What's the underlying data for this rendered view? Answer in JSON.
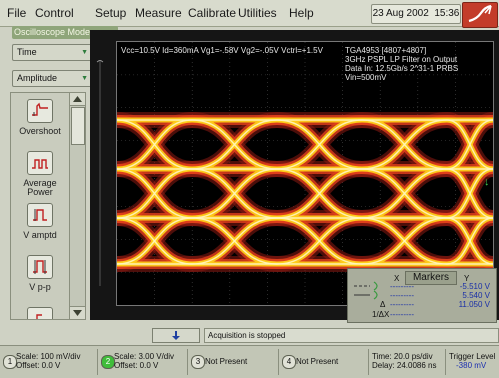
{
  "menu": {
    "items": [
      "File",
      "Control",
      "Setup",
      "Measure",
      "Calibrate",
      "Utilities",
      "Help"
    ],
    "date": "23 Aug 2002",
    "time": "15:36"
  },
  "mode_label": "Oscilloscope Mode",
  "left_panel": {
    "time_dropdown": "Time",
    "amplitude_dropdown": "Amplitude",
    "measurements": [
      {
        "label": "Overshoot",
        "icon": "overshoot-icon"
      },
      {
        "label": "Average Power",
        "icon": "average-power-icon"
      },
      {
        "label": "V amptd",
        "icon": "v-amplitude-icon"
      },
      {
        "label": "V p-p",
        "icon": "v-peak-to-peak-icon"
      }
    ]
  },
  "display": {
    "conditions": "Vcc=10.5V Id=360mA Vg1=-.58V Vg2=-.05V Vctrl=+1.5V",
    "info_lines": [
      "TGA4953 [4807+4807]",
      "3GHz PSPL LP Filter on Output",
      "Data In: 12.5Gb/s 2^31-1 PRBS",
      "Vin=500mV"
    ],
    "trace_colors": {
      "outer": "#8a1a12",
      "mid": "#e0401c",
      "core": "#ffd21a",
      "hot": "#fff6c0"
    }
  },
  "markers": {
    "title": "Markers",
    "col_x": "X",
    "col_y": "Y",
    "x1": "---------",
    "x2": "---------",
    "dx": "---------",
    "idx": "---------",
    "dx_label": "Δ",
    "idx_label": "1/ΔX",
    "y1": "-5.510 V",
    "y2": "5.540 V",
    "dy": "11.050 V"
  },
  "status": {
    "acquisition": "Acquisition is stopped"
  },
  "bottom": {
    "ch1": {
      "number": "1",
      "scale": "Scale: 100 mV/div",
      "offset": "Offset: 0.0 V"
    },
    "ch2": {
      "number": "2",
      "scale": "Scale: 3.00 V/div",
      "offset": "Offset: 0.0 V"
    },
    "ch3": {
      "number": "3",
      "text": "Not Present"
    },
    "ch4": {
      "number": "4",
      "text": "Not Present"
    },
    "timebase": {
      "time": "Time: 20.0 ps/div",
      "delay": "Delay: 24.0086 ns"
    },
    "trigger": {
      "label": "Trigger Level",
      "value": "-380 mV"
    }
  }
}
